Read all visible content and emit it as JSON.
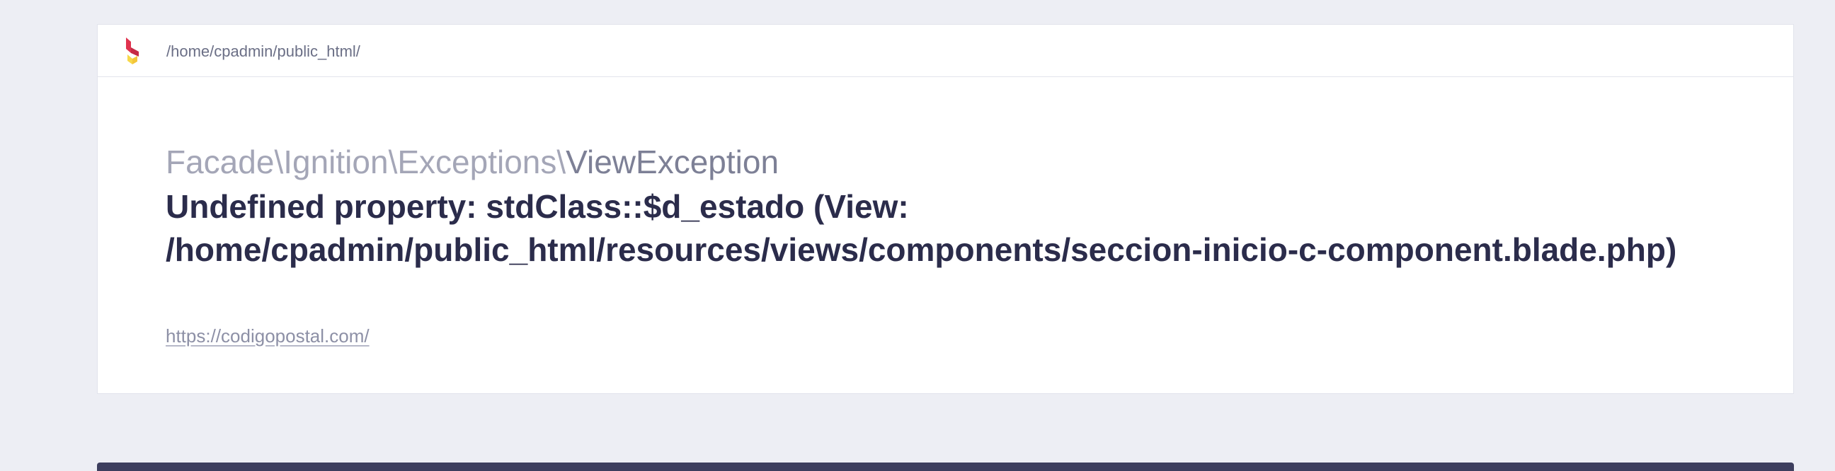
{
  "topbar": {
    "logo_icon": "ignition-flame-icon",
    "path": "/home/cpadmin/public_html/"
  },
  "exception": {
    "namespace_parts": [
      "Facade",
      "Ignition",
      "Exceptions"
    ],
    "separator": "\\",
    "class_name": "ViewException",
    "message": "Undefined property: stdClass::$d_estado (View: /home/cpadmin/public_html/resources/views/components/seccion-inicio-c-component.blade.php)",
    "url": "https://codigopostal.com/"
  },
  "colors": {
    "background": "#edeef4",
    "card": "#ffffff",
    "message_text": "#2b2c4b",
    "muted_text": "#a4a6b7",
    "footer_bar": "#3d3e5e",
    "logo_red": "#e0334e",
    "logo_yellow": "#f7d84a"
  }
}
